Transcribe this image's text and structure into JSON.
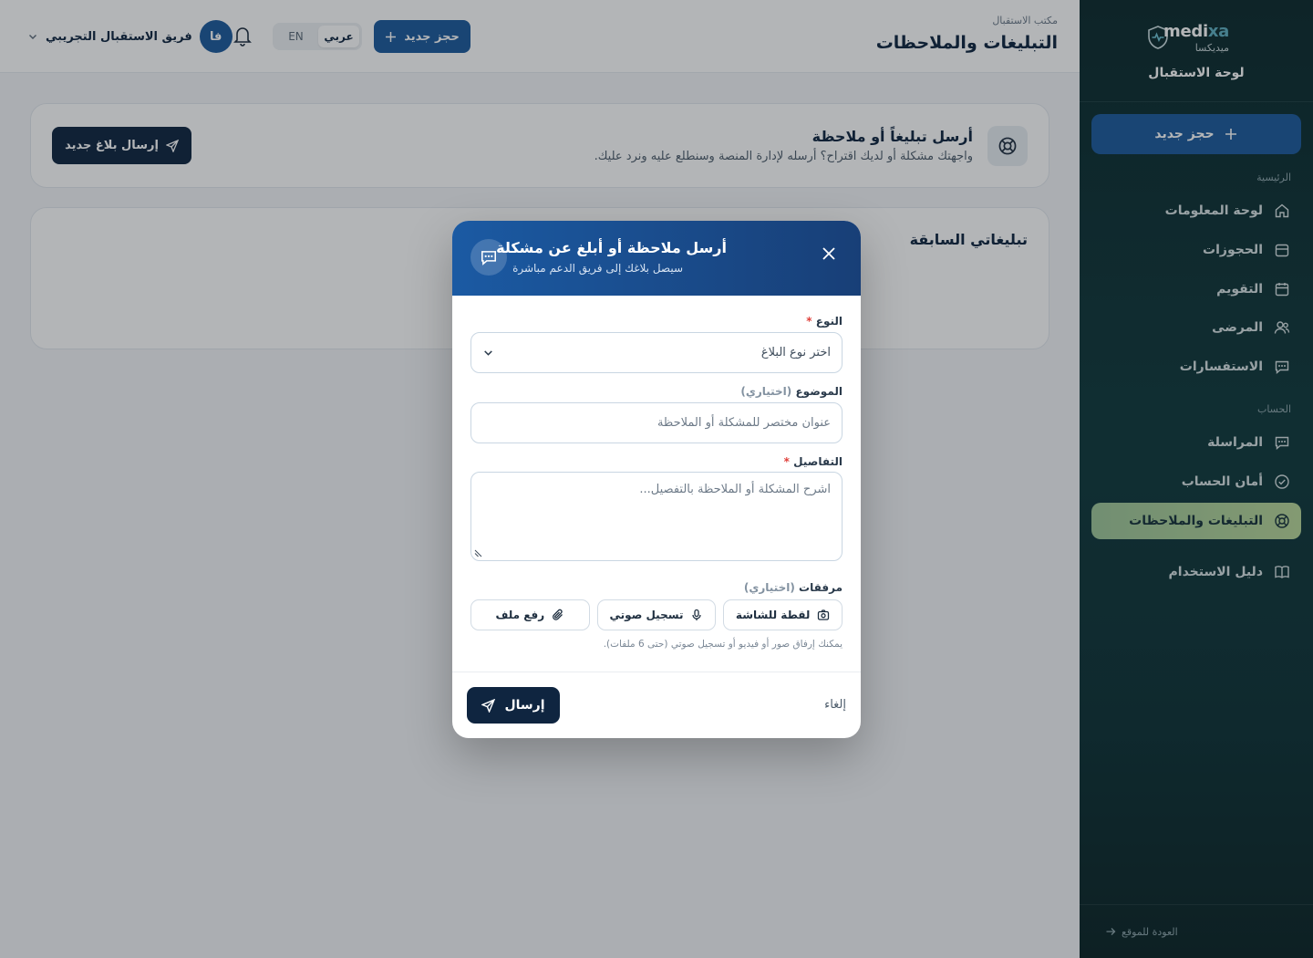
{
  "brand": {
    "name_latin_1": "medi",
    "name_latin_2": "xa",
    "name_ar": "ميديكسا",
    "panel_title": "لوحة الاستقبال"
  },
  "sidebar": {
    "new_booking": "حجز جديد",
    "section_main": "الرئيسية",
    "section_account": "الحساب",
    "items": [
      {
        "label": "لوحة المعلومات",
        "icon": "home-icon"
      },
      {
        "label": "الحجوزات",
        "icon": "bookings-icon"
      },
      {
        "label": "التقويم",
        "icon": "calendar-icon"
      },
      {
        "label": "المرضى",
        "icon": "patients-icon"
      },
      {
        "label": "الاستفسارات",
        "icon": "chat-icon"
      },
      {
        "label": "المراسلة",
        "icon": "messages-icon"
      },
      {
        "label": "أمان الحساب",
        "icon": "shield-check-icon"
      },
      {
        "label": "التبليغات والملاحظات",
        "icon": "lifebuoy-icon",
        "active": true
      },
      {
        "label": "دليل الاستخدام",
        "icon": "book-icon"
      }
    ],
    "back_to_site": "العودة للموقع"
  },
  "header": {
    "breadcrumb": "مكتب الاستقبال",
    "title": "التبليغات والملاحظات",
    "new_booking": "حجز جديد",
    "lang_ar": "عربي",
    "lang_en": "EN",
    "user_initials": "فا",
    "user_name": "فريق الاستقبال التجريبي"
  },
  "intro": {
    "title": "أرسل تبليغاً أو ملاحظة",
    "description": "واجهتك مشكلة أو لديك اقتراح؟ أرسله لإدارة المنصة وسنطلع عليه ونرد عليك.",
    "button": "إرسال بلاغ جديد"
  },
  "history": {
    "title": "تبليغاتي السابقة"
  },
  "modal": {
    "title": "أرسل ملاحظة أو أبلغ عن مشكلة",
    "subtitle": "سيصل بلاغك إلى فريق الدعم مباشرة",
    "type_label": "النوع",
    "type_placeholder": "اختر نوع البلاغ",
    "subject_label": "الموضوع",
    "optional_tag": "(اختياري)",
    "subject_placeholder": "عنوان مختصر للمشكلة أو الملاحظة",
    "details_label": "التفاصيل",
    "details_placeholder": "اشرح المشكلة أو الملاحظة بالتفصيل...",
    "attachments_label": "مرفقات",
    "attach_screenshot": "لقطة للشاشة",
    "attach_voice": "تسجيل صوتي",
    "attach_file": "رفع ملف",
    "attach_hint": "يمكنك إرفاق صور أو فيديو أو تسجيل صوتي (حتى 6 ملفات).",
    "send": "إرسال",
    "cancel": "إلغاء"
  },
  "colors": {
    "primary": "#1d5a9c",
    "dark": "#0f2540",
    "active_nav": "#b9d79a",
    "sidebar_bg": "#10393c",
    "required": "#e0403b"
  }
}
